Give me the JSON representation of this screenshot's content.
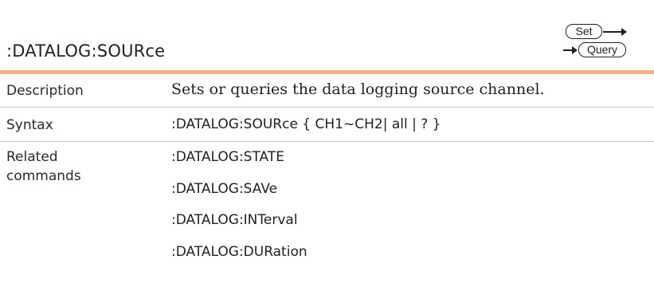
{
  "header": {
    "command": ":DATALOG:SOURce",
    "set_badge": "Set",
    "query_badge": "Query"
  },
  "rows": {
    "description": {
      "label": "Description",
      "value": "Sets or queries the data logging source channel."
    },
    "syntax": {
      "label": "Syntax",
      "value": ":DATALOG:SOURce { CH1~CH2| all | ? }"
    },
    "related": {
      "label_line1": "Related",
      "label_line2": "commands",
      "items": [
        ":DATALOG:STATE",
        ":DATALOG:SAVe",
        ":DATALOG:INTerval",
        ":DATALOG:DURation"
      ]
    }
  },
  "colors": {
    "accent_rule": "#f4b083",
    "row_divider": "#c8c8c8"
  }
}
